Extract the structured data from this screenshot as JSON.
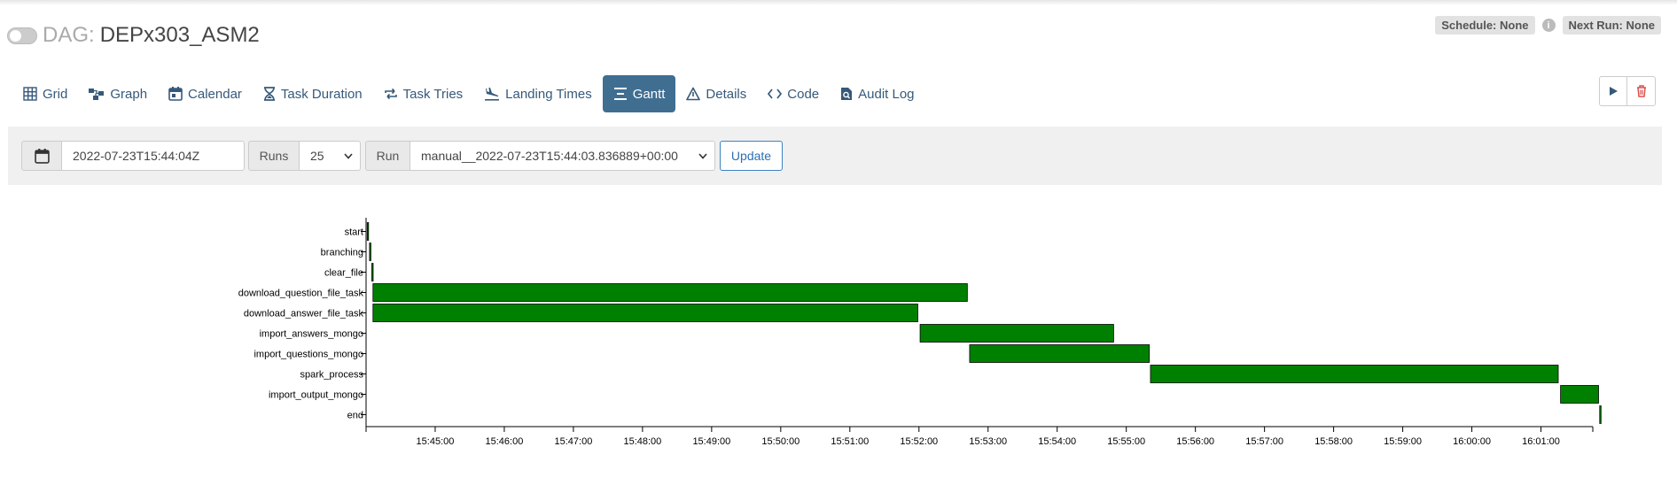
{
  "header": {
    "dag_prefix": "DAG:",
    "dag_id": "DEPx303_ASM2"
  },
  "badges": {
    "schedule": "Schedule: None",
    "next_run": "Next Run: None"
  },
  "tabs": [
    {
      "label": "Grid",
      "icon": "grid-icon"
    },
    {
      "label": "Graph",
      "icon": "graph-icon"
    },
    {
      "label": "Calendar",
      "icon": "calendar-icon"
    },
    {
      "label": "Task Duration",
      "icon": "hourglass-icon"
    },
    {
      "label": "Task Tries",
      "icon": "repeat-icon"
    },
    {
      "label": "Landing Times",
      "icon": "landing-icon"
    },
    {
      "label": "Gantt",
      "icon": "gantt-icon",
      "active": true
    },
    {
      "label": "Details",
      "icon": "warning-triangle-icon"
    },
    {
      "label": "Code",
      "icon": "code-icon"
    },
    {
      "label": "Audit Log",
      "icon": "search-file-icon"
    }
  ],
  "filter": {
    "date_value": "2022-07-23T15:44:04Z",
    "runs_label": "Runs",
    "runs_value": "25",
    "run_label": "Run",
    "run_value": "manual__2022-07-23T15:44:03.836889+00:00",
    "update_label": "Update"
  },
  "colors": {
    "bar": "#008000",
    "accent": "#3f6e91",
    "link": "#36597a"
  },
  "chart_data": {
    "type": "gantt",
    "x_ticks": [
      "15:45:00",
      "15:46:00",
      "15:47:00",
      "15:48:00",
      "15:49:00",
      "15:50:00",
      "15:51:00",
      "15:52:00",
      "15:53:00",
      "15:54:00",
      "15:55:00",
      "15:56:00",
      "15:57:00",
      "15:58:00",
      "15:59:00",
      "16:00:00",
      "16:01:00"
    ],
    "x_range": [
      "15:44:00",
      "16:01:45"
    ],
    "tasks": [
      {
        "name": "start",
        "start": "15:44:01",
        "end": "15:44:02"
      },
      {
        "name": "branching",
        "start": "15:44:03",
        "end": "15:44:04"
      },
      {
        "name": "clear_file",
        "start": "15:44:05",
        "end": "15:44:06"
      },
      {
        "name": "download_question_file_task",
        "start": "15:44:06",
        "end": "15:52:42"
      },
      {
        "name": "download_answer_file_task",
        "start": "15:44:06",
        "end": "15:51:59"
      },
      {
        "name": "import_answers_mongo",
        "start": "15:52:01",
        "end": "15:54:49"
      },
      {
        "name": "import_questions_mongo",
        "start": "15:52:44",
        "end": "15:55:20"
      },
      {
        "name": "spark_process",
        "start": "15:55:21",
        "end": "16:01:15"
      },
      {
        "name": "import_output_mongo",
        "start": "16:01:17",
        "end": "16:01:50"
      },
      {
        "name": "end",
        "start": "16:01:51",
        "end": "16:01:52"
      }
    ]
  }
}
